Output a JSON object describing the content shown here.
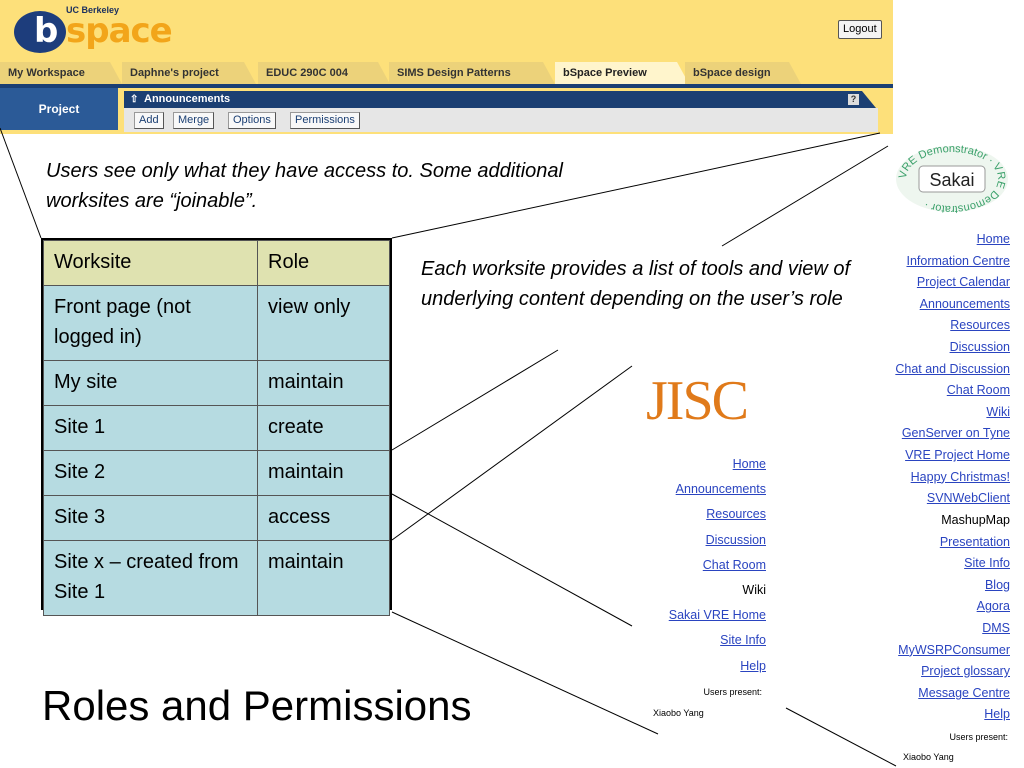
{
  "bspace": {
    "logo": {
      "institution": "UC Berkeley",
      "b": "b",
      "name": "space"
    },
    "logout_label": "Logout",
    "tabs": [
      {
        "label": "My Workspace",
        "active": false
      },
      {
        "label": "Daphne's project",
        "active": false
      },
      {
        "label": "EDUC 290C 004",
        "active": false
      },
      {
        "label": "SIMS Design Patterns",
        "active": false
      },
      {
        "label": "bSpace Preview",
        "active": true
      },
      {
        "label": "bSpace design",
        "active": false
      }
    ],
    "project_label": "Project",
    "announcements": {
      "title": "Announcements",
      "arrow": "⇧",
      "help": "?",
      "buttons": [
        "Add",
        "Merge",
        "Options",
        "Permissions"
      ]
    },
    "colors": {
      "header_bg": "#fde07a",
      "nav_blue": "#1b3f73",
      "logo_orange": "#f2a51a"
    }
  },
  "slide": {
    "caption_access": "Users see only what they have access to. Some additional worksites are “joinable”.",
    "caption_tools": "Each worksite provides a list of tools and view of underlying content depending on the user’s role",
    "title": "Roles and Permissions"
  },
  "table": {
    "headers": [
      "Worksite",
      "Role"
    ],
    "rows": [
      [
        "Front page (not logged in)",
        "view only"
      ],
      [
        "My site",
        "maintain"
      ],
      [
        "Site 1",
        "create"
      ],
      [
        "Site 2",
        "maintain"
      ],
      [
        "Site 3",
        "access"
      ],
      [
        "Site x – created from Site 1",
        "maintain"
      ]
    ]
  },
  "jisc": {
    "logo": "JISC",
    "links": [
      {
        "label": "Home",
        "link": true
      },
      {
        "label": "Announcements",
        "link": true
      },
      {
        "label": "Resources",
        "link": true
      },
      {
        "label": "Discussion",
        "link": true
      },
      {
        "label": "Chat Room",
        "link": true
      },
      {
        "label": "Wiki",
        "link": false
      },
      {
        "label": "Sakai VRE Home",
        "link": true
      },
      {
        "label": "Site Info",
        "link": true
      },
      {
        "label": "Help",
        "link": true
      }
    ],
    "users_present_label": "Users present:",
    "user": "Xiaobo Yang"
  },
  "sakai": {
    "logo_name": "Sakai",
    "logo_ring": "VRE Demonstrator · VRE Demonstrator ·",
    "links": [
      {
        "label": "Home",
        "link": true
      },
      {
        "label": "Information Centre",
        "link": true
      },
      {
        "label": "Project Calendar",
        "link": true
      },
      {
        "label": "Announcements",
        "link": true
      },
      {
        "label": "Resources",
        "link": true
      },
      {
        "label": "Discussion",
        "link": true
      },
      {
        "label": "Chat and Discussion",
        "link": true
      },
      {
        "label": "Chat Room",
        "link": true
      },
      {
        "label": "Wiki",
        "link": true
      },
      {
        "label": "GenServer on Tyne",
        "link": true
      },
      {
        "label": "VRE Project Home",
        "link": true
      },
      {
        "label": "Happy Christmas!",
        "link": true
      },
      {
        "label": "SVNWebClient",
        "link": true
      },
      {
        "label": "MashupMap",
        "link": false
      },
      {
        "label": "Presentation",
        "link": true
      },
      {
        "label": "Site Info",
        "link": true
      },
      {
        "label": "Blog",
        "link": true
      },
      {
        "label": "Agora",
        "link": true
      },
      {
        "label": "DMS",
        "link": true
      },
      {
        "label": "MyWSRPConsumer",
        "link": true
      },
      {
        "label": "Project glossary",
        "link": true
      },
      {
        "label": "Message Centre",
        "link": true
      },
      {
        "label": "Help",
        "link": true
      }
    ],
    "users_present_label": "Users present:",
    "user": "Xiaobo Yang"
  }
}
